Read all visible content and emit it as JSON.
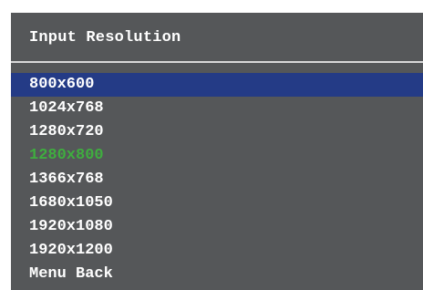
{
  "menu": {
    "title": "Input Resolution",
    "items": [
      {
        "label": "800x600",
        "selected": true,
        "active": false
      },
      {
        "label": "1024x768",
        "selected": false,
        "active": false
      },
      {
        "label": "1280x720",
        "selected": false,
        "active": false
      },
      {
        "label": "1280x800",
        "selected": false,
        "active": true
      },
      {
        "label": "1366x768",
        "selected": false,
        "active": false
      },
      {
        "label": "1680x1050",
        "selected": false,
        "active": false
      },
      {
        "label": "1920x1080",
        "selected": false,
        "active": false
      },
      {
        "label": "1920x1200",
        "selected": false,
        "active": false
      },
      {
        "label": "Menu Back",
        "selected": false,
        "active": false
      }
    ]
  },
  "colors": {
    "panel_bg": "#555759",
    "highlight_bg": "#243b86",
    "active_text": "#3fae3f",
    "text": "#ffffff"
  }
}
